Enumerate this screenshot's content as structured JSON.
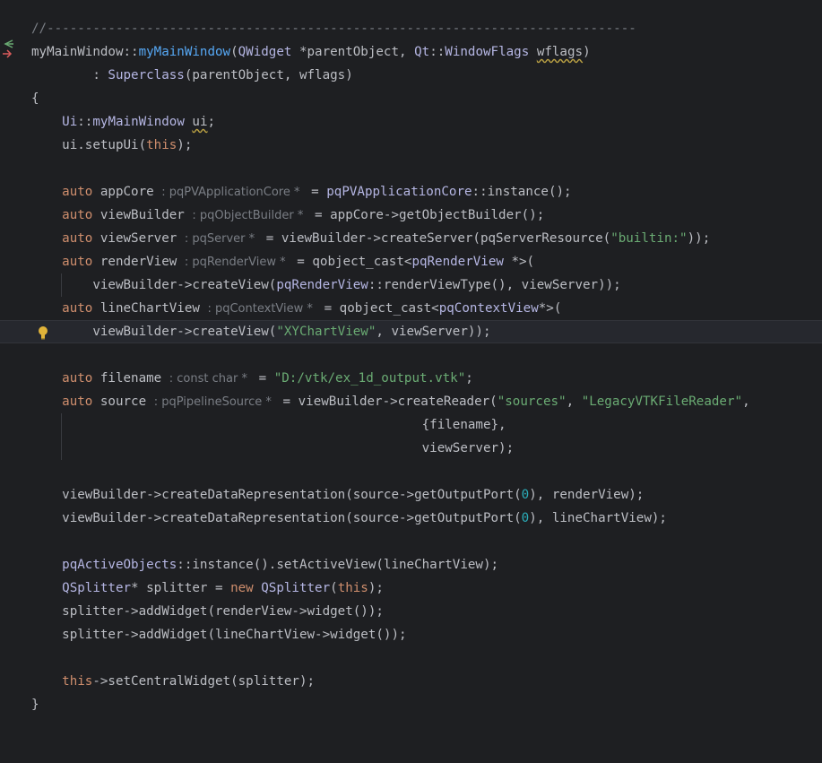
{
  "editor": {
    "lines": [
      {
        "t": "//-----------------------------------------------------------------------------"
      },
      {
        "t": "myMainWindow::myMainWindow(QWidget *parentObject, Qt::WindowFlags wflags)"
      },
      {
        "t": "        : Superclass(parentObject, wflags)"
      },
      {
        "t": "{"
      },
      {
        "t": "    Ui::myMainWindow ui;"
      },
      {
        "t": "    ui.setupUi(this);"
      },
      {
        "t": ""
      },
      {
        "t": "    auto appCore : pqPVApplicationCore * = pqPVApplicationCore::instance();"
      },
      {
        "t": "    auto viewBuilder : pqObjectBuilder * = appCore->getObjectBuilder();"
      },
      {
        "t": "    auto viewServer : pqServer * = viewBuilder->createServer(pqServerResource(\"builtin:\"));"
      },
      {
        "t": "    auto renderView : pqRenderView * = qobject_cast<pqRenderView *>("
      },
      {
        "t": "            viewBuilder->createView(pqRenderView::renderViewType(), viewServer));"
      },
      {
        "t": "    auto lineChartView : pqContextView * = qobject_cast<pqContextView*>("
      },
      {
        "t": "            viewBuilder->createView(\"XYChartView\", viewServer));"
      },
      {
        "t": ""
      },
      {
        "t": "    auto filename : const char * = \"D:/vtk/ex_1d_output.vtk\";"
      },
      {
        "t": "    auto source : pqPipelineSource * = viewBuilder->createReader(\"sources\", \"LegacyVTKFileReader\","
      },
      {
        "t": "                                                   {filename},"
      },
      {
        "t": "                                                   viewServer);"
      },
      {
        "t": ""
      },
      {
        "t": "    viewBuilder->createDataRepresentation(source->getOutputPort(0), renderView);"
      },
      {
        "t": "    viewBuilder->createDataRepresentation(source->getOutputPort(0), lineChartView);"
      },
      {
        "t": ""
      },
      {
        "t": "    pqActiveObjects::instance().setActiveView(lineChartView);"
      },
      {
        "t": "    QSplitter* splitter = new QSplitter(this);"
      },
      {
        "t": "    splitter->addWidget(renderView->widget());"
      },
      {
        "t": "    splitter->addWidget(lineChartView->widget());"
      },
      {
        "t": ""
      },
      {
        "t": "    this->setCentralWidget(splitter);"
      },
      {
        "t": "}"
      }
    ],
    "current_line": 14,
    "gutter_icons": [
      "override-icon",
      "lightbulb-icon"
    ],
    "colors": {
      "background": "#1e1f22",
      "keyword": "#cf8e6d",
      "function": "#56a8f5",
      "string": "#6aab73",
      "number": "#2aacb8",
      "comment": "#7a7e85",
      "text": "#bcbec4"
    }
  }
}
